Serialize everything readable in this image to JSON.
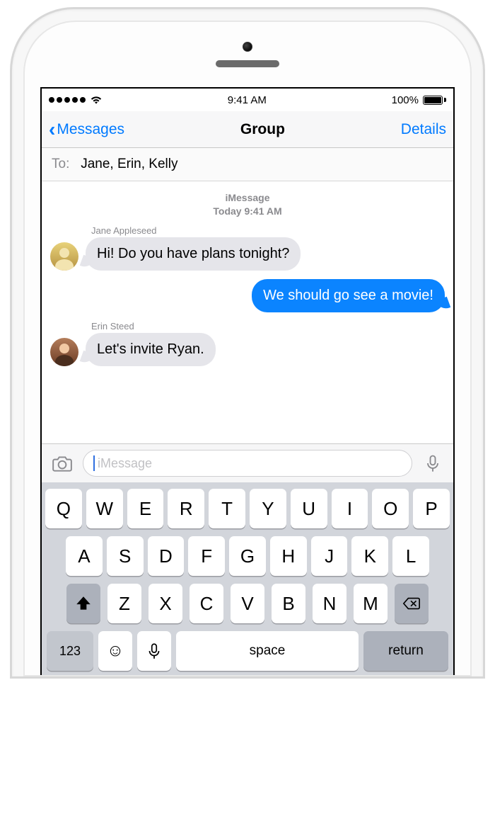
{
  "statusbar": {
    "time": "9:41 AM",
    "battery_pct": "100%"
  },
  "navbar": {
    "back_label": "Messages",
    "title": "Group",
    "details_label": "Details"
  },
  "to_field": {
    "prefix": "To:",
    "recipients": "Jane, Erin, Kelly"
  },
  "conversation": {
    "service_label": "iMessage",
    "timestamp": "Today 9:41 AM",
    "messages": [
      {
        "sender": "Jane Appleseed",
        "side": "left",
        "text": "Hi! Do you have plans tonight?"
      },
      {
        "sender": null,
        "side": "right",
        "text": "We should go see a movie!"
      },
      {
        "sender": "Erin Steed",
        "side": "left",
        "text": "Let's invite Ryan."
      }
    ]
  },
  "input": {
    "placeholder": "iMessage"
  },
  "keyboard": {
    "row1": [
      "Q",
      "W",
      "E",
      "R",
      "T",
      "Y",
      "U",
      "I",
      "O",
      "P"
    ],
    "row2": [
      "A",
      "S",
      "D",
      "F",
      "G",
      "H",
      "J",
      "K",
      "L"
    ],
    "row3": [
      "Z",
      "X",
      "C",
      "V",
      "B",
      "N",
      "M"
    ],
    "numbers_label": "123",
    "space_label": "space",
    "return_label": "return"
  }
}
